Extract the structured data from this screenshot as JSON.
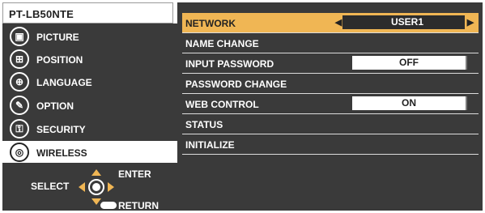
{
  "model": "PT-LB50NTE",
  "sidebar": {
    "items": [
      {
        "label": "PICTURE",
        "icon": "picture-icon"
      },
      {
        "label": "POSITION",
        "icon": "position-icon"
      },
      {
        "label": "LANGUAGE",
        "icon": "language-icon"
      },
      {
        "label": "OPTION",
        "icon": "option-icon"
      },
      {
        "label": "SECURITY",
        "icon": "security-icon"
      },
      {
        "label": "WIRELESS",
        "icon": "wireless-icon",
        "active": true
      }
    ]
  },
  "help": {
    "select": "SELECT",
    "enter": "ENTER",
    "return": "RETURN"
  },
  "wireless_menu": {
    "network": {
      "label": "NETWORK",
      "value": "USER1"
    },
    "name_change": {
      "label": "NAME CHANGE"
    },
    "input_password": {
      "label": "INPUT PASSWORD",
      "value": "OFF"
    },
    "password_change": {
      "label": "PASSWORD CHANGE"
    },
    "web_control": {
      "label": "WEB CONTROL",
      "value": "ON"
    },
    "status": {
      "label": "STATUS"
    },
    "initialize": {
      "label": "INITIALIZE"
    }
  },
  "colors": {
    "highlight": "#f0b654",
    "panel": "#3a3a3a",
    "text": "#ffffff"
  }
}
